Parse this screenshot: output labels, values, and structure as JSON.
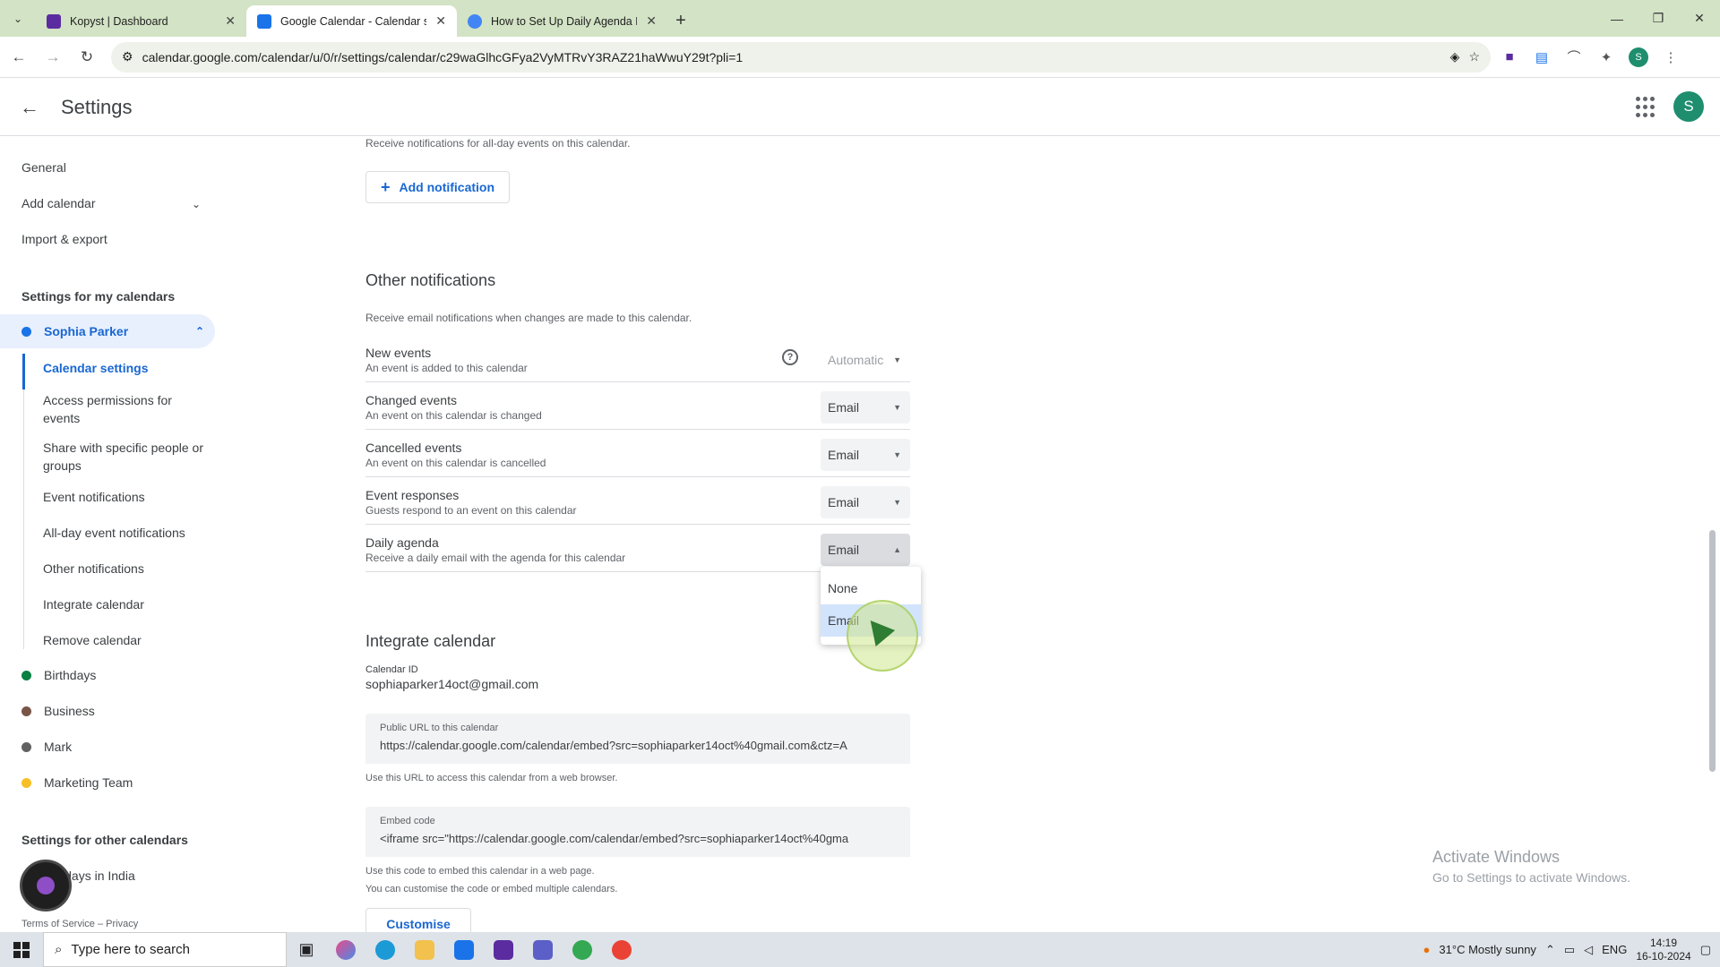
{
  "browser": {
    "tabs": [
      {
        "title": "Kopyst | Dashboard",
        "favicon_color": "#5b2ca0"
      },
      {
        "title": "Google Calendar - Calendar settings",
        "favicon_color": "#1a73e8"
      },
      {
        "title": "How to Set Up Daily Agenda Emails",
        "favicon_color": "#4285f4"
      }
    ],
    "url": "calendar.google.com/calendar/u/0/r/settings/calendar/c29waGlhcGFya2VyMTRvY3RAZ21haWwuY29t?pli=1",
    "profile_initial": "S"
  },
  "header": {
    "title": "Settings",
    "avatar_initial": "S"
  },
  "sidebar": {
    "top_items": [
      "General",
      "Add calendar",
      "Import & export"
    ],
    "my_calendars_heading": "Settings for my calendars",
    "selected_calendar": {
      "name": "Sophia Parker",
      "color": "#1a73e8"
    },
    "sub_items": [
      "Calendar settings",
      "Access permissions for events",
      "Share with specific people or groups",
      "Event notifications",
      "All-day event notifications",
      "Other notifications",
      "Integrate calendar",
      "Remove calendar"
    ],
    "other_calendars": [
      {
        "name": "Birthdays",
        "color": "#0b8043"
      },
      {
        "name": "Business",
        "color": "#795548"
      },
      {
        "name": "Mark",
        "color": "#616161"
      },
      {
        "name": "Marketing Team",
        "color": "#f6bf26"
      }
    ],
    "other_calendars_heading": "Settings for other calendars",
    "holidays": "Holidays in India",
    "footer": "Terms of Service – Privacy"
  },
  "main": {
    "allday_note": "Receive notifications for all-day events on this calendar.",
    "add_notification": "Add notification",
    "other_notifications": {
      "title": "Other notifications",
      "desc": "Receive email notifications when changes are made to this calendar.",
      "rows": [
        {
          "name": "New events",
          "desc": "An event is added to this calendar",
          "value": "Automatic"
        },
        {
          "name": "Changed events",
          "desc": "An event on this calendar is changed",
          "value": "Email"
        },
        {
          "name": "Cancelled events",
          "desc": "An event on this calendar is cancelled",
          "value": "Email"
        },
        {
          "name": "Event responses",
          "desc": "Guests respond to an event on this calendar",
          "value": "Email"
        },
        {
          "name": "Daily agenda",
          "desc": "Receive a daily email with the agenda for this calendar",
          "value": "Email"
        }
      ]
    },
    "dropdown_options": [
      "None",
      "Email"
    ],
    "integrate": {
      "title": "Integrate calendar",
      "calendar_id_label": "Calendar ID",
      "calendar_id": "sophiaparker14oct@gmail.com",
      "public_url_label": "Public URL to this calendar",
      "public_url": "https://calendar.google.com/calendar/embed?src=sophiaparker14oct%40gmail.com&ctz=A",
      "public_url_note": "Use this URL to access this calendar from a web browser.",
      "embed_label": "Embed code",
      "embed_code": "<iframe src=\"https://calendar.google.com/calendar/embed?src=sophiaparker14oct%40gma",
      "embed_note1": "Use this code to embed this calendar in a web page.",
      "embed_note2": "You can customise the code or embed multiple calendars.",
      "customise": "Customise"
    }
  },
  "watermark": {
    "line1": "Activate Windows",
    "line2": "Go to Settings to activate Windows."
  },
  "taskbar": {
    "search_placeholder": "Type here to search",
    "weather": "31°C  Mostly sunny",
    "lang": "ENG",
    "time": "14:19",
    "date": "16-10-2024"
  }
}
